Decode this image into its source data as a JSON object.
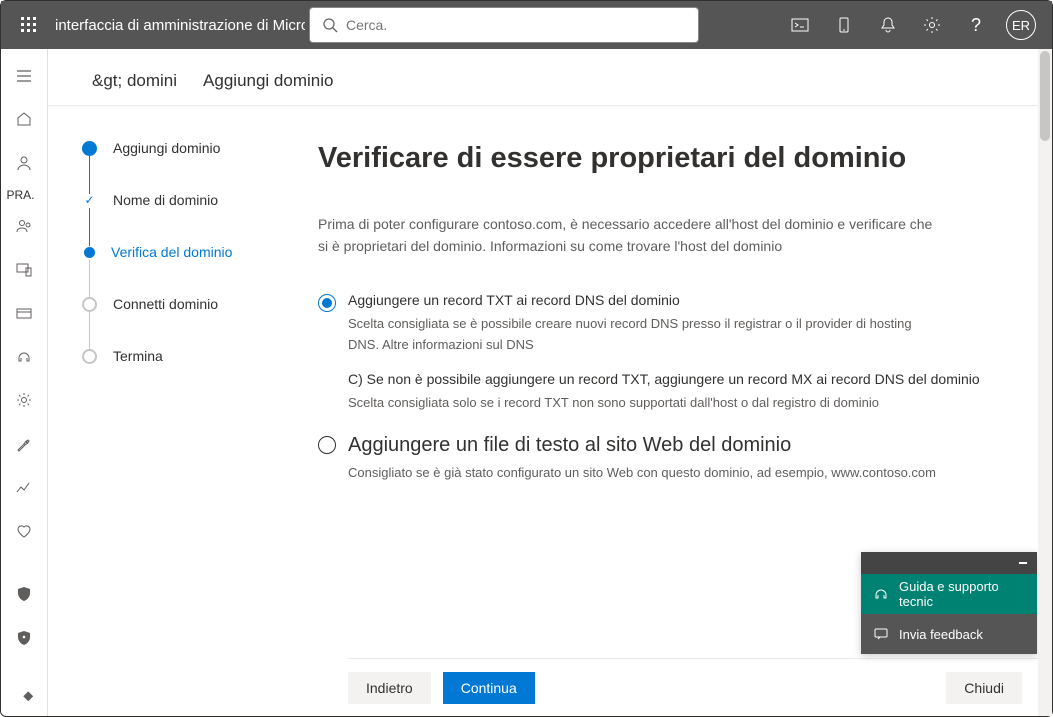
{
  "topbar": {
    "brand": "interfaccia di amministrazione di Microsoft",
    "search_placeholder": "Cerca.",
    "avatar": "ER"
  },
  "rail": {
    "text": "PRA."
  },
  "crumbs": {
    "a": "&gt; domini",
    "b": "Aggiungi dominio"
  },
  "steps": {
    "s1": "Aggiungi dominio",
    "s2": "Nome di dominio",
    "s3": "Verifica del dominio",
    "s4": "Connetti dominio",
    "s5": "Termina"
  },
  "page": {
    "title": "Verificare di essere proprietari del dominio",
    "intro": "Prima di poter configurare contoso.com, è necessario accedere all'host del dominio e verificare che si è proprietari del dominio. Informazioni su come trovare l'host del dominio",
    "opt1_title": "Aggiungere un record TXT ai record DNS del dominio",
    "opt1_desc": "Scelta consigliata se è possibile creare nuovi record DNS presso il registrar o il provider di hosting DNS. Altre informazioni sul DNS",
    "optc": "C) Se non è possibile aggiungere un record TXT, aggiungere un record MX ai record DNS del dominio",
    "optc_desc": "Scelta consigliata solo se i record TXT non sono supportati dall'host o dal registro di dominio",
    "opt3_title": "Aggiungere un file di testo al sito Web del dominio",
    "opt3_desc": "Consigliato se è già stato configurato un sito Web con questo dominio, ad esempio, www.contoso.com"
  },
  "buttons": {
    "back": "Indietro",
    "next": "Continua",
    "close": "Chiudi"
  },
  "float": {
    "help": "Guida e supporto tecnic",
    "feedback": "Invia feedback"
  }
}
